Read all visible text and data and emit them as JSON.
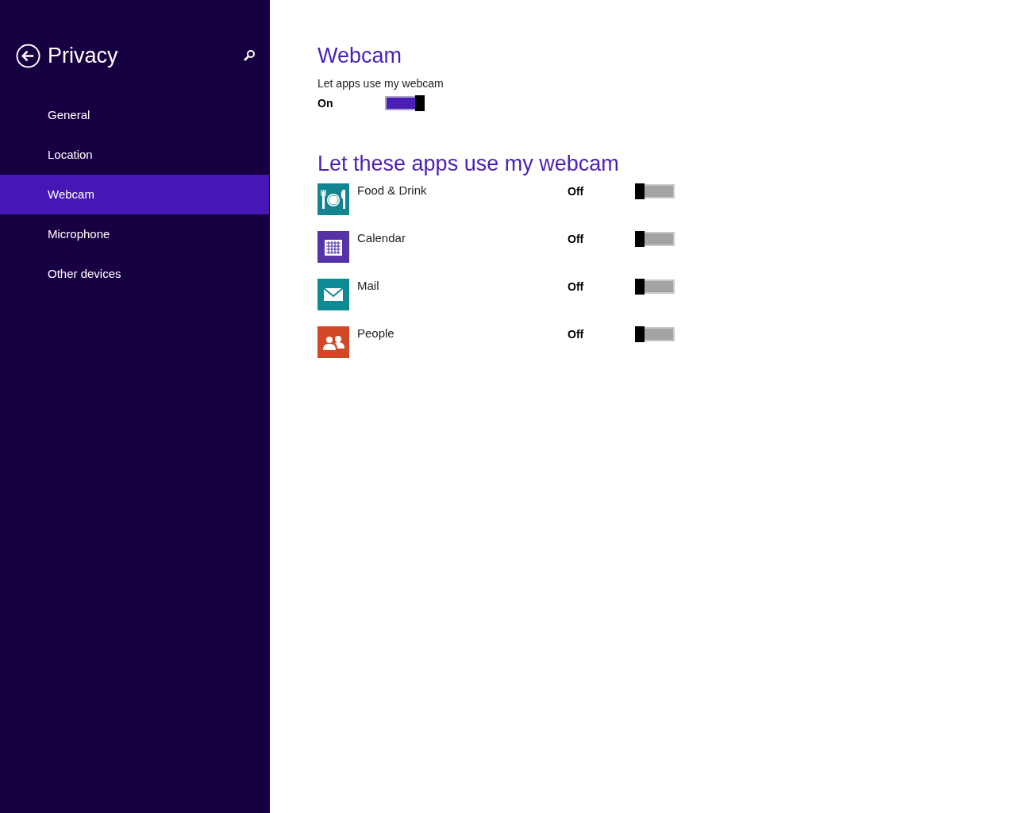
{
  "sidebar": {
    "title": "Privacy",
    "items": [
      {
        "label": "General",
        "selected": false
      },
      {
        "label": "Location",
        "selected": false
      },
      {
        "label": "Webcam",
        "selected": true
      },
      {
        "label": "Microphone",
        "selected": false
      },
      {
        "label": "Other devices",
        "selected": false
      }
    ]
  },
  "main": {
    "heading": "Webcam",
    "setting_label": "Let apps use my webcam",
    "setting_state": "On",
    "setting_on": true,
    "apps_heading": "Let these apps use my webcam",
    "apps": [
      {
        "name": "Food & Drink",
        "kind": "food",
        "color": "#128590",
        "state": "Off",
        "on": false
      },
      {
        "name": "Calendar",
        "kind": "calendar",
        "color": "#5632a8",
        "state": "Off",
        "on": false
      },
      {
        "name": "Mail",
        "kind": "mail",
        "color": "#0d8a94",
        "state": "Off",
        "on": false
      },
      {
        "name": "People",
        "kind": "people",
        "color": "#d24726",
        "state": "Off",
        "on": false
      }
    ]
  }
}
